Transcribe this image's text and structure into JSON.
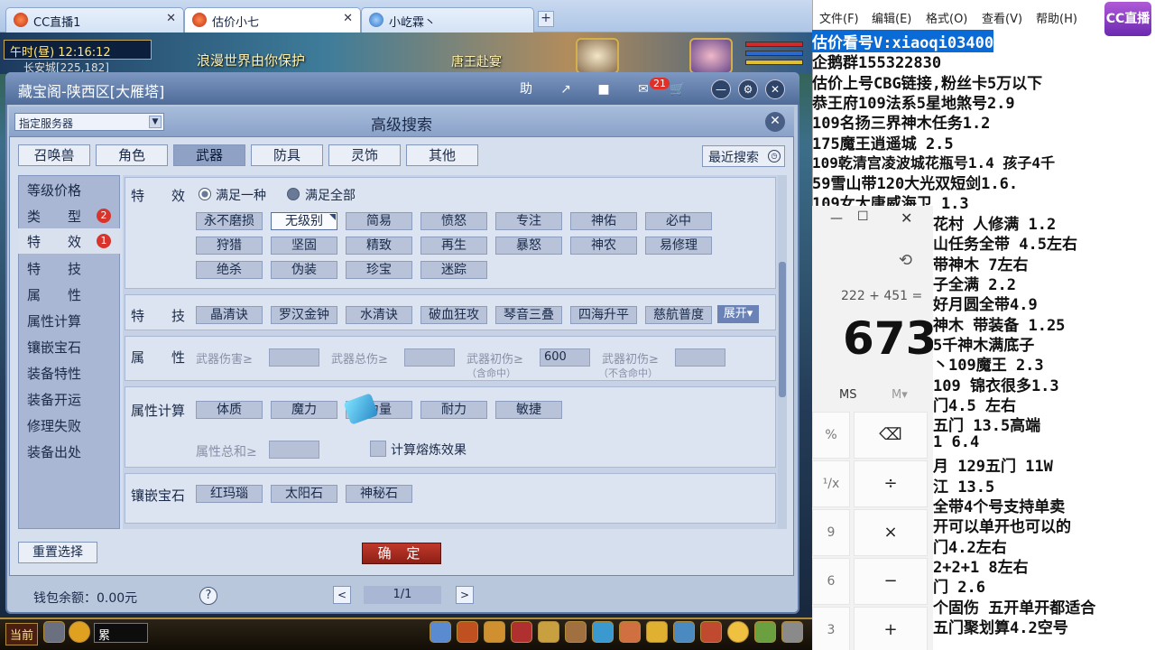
{
  "browser": {
    "tabs": [
      {
        "label": "CC直播1"
      },
      {
        "label": "估价小七"
      },
      {
        "label": "小屹霖丶"
      }
    ],
    "new_tab": "+"
  },
  "game": {
    "clock": "午时(昼)  12:16:12",
    "location": "长安城[225,182]",
    "banner_left": "浪漫世界由你保护",
    "banner_right": "唐王赴宴",
    "bottom_bar": {
      "label": "当前",
      "input_value": "累"
    }
  },
  "window": {
    "title": "藏宝阁-陕西区[大雁塔]",
    "buttons": {
      "help": "助",
      "share": "↗",
      "stop": "■",
      "messages_badge": "21",
      "cart": "🛒",
      "minimize": "—",
      "settings": "⚙",
      "close": "✕"
    }
  },
  "dialog": {
    "server_placeholder": "指定服务器",
    "title": "高级搜索",
    "close": "✕",
    "categories": [
      "召唤兽",
      "角色",
      "武器",
      "防具",
      "灵饰",
      "其他"
    ],
    "active_category": "武器",
    "recent_search": "最近搜索",
    "sidebar": [
      {
        "label": "等级价格",
        "badge": ""
      },
      {
        "label": "类　　型",
        "badge": "2"
      },
      {
        "label": "特　　效",
        "badge": "1"
      },
      {
        "label": "特　　技",
        "badge": ""
      },
      {
        "label": "属　　性",
        "badge": ""
      },
      {
        "label": "属性计算",
        "badge": ""
      },
      {
        "label": "镶嵌宝石",
        "badge": ""
      },
      {
        "label": "装备特性",
        "badge": ""
      },
      {
        "label": "装备开运",
        "badge": ""
      },
      {
        "label": "修理失败",
        "badge": ""
      },
      {
        "label": "装备出处",
        "badge": ""
      }
    ],
    "effects": {
      "label": "特　　效",
      "options": [
        "满足一种",
        "满足全部"
      ],
      "selected_option": "满足全部",
      "chips": [
        "永不磨损",
        "无级别",
        "简易",
        "愤怒",
        "专注",
        "神佑",
        "必中",
        "狩猎",
        "坚固",
        "精致",
        "再生",
        "暴怒",
        "神农",
        "易修理",
        "绝杀",
        "伪装",
        "珍宝",
        "迷踪"
      ],
      "selected_chip": "无级别"
    },
    "skills": {
      "label": "特　　技",
      "chips": [
        "晶清诀",
        "罗汉金钟",
        "水清诀",
        "破血狂攻",
        "琴音三叠",
        "四海升平",
        "慈航普度"
      ],
      "expand": "展开▾"
    },
    "attributes": {
      "label": "属　　性",
      "fields": [
        {
          "label": "武器伤害≥",
          "value": "",
          "sub": ""
        },
        {
          "label": "武器总伤≥",
          "value": "",
          "sub": ""
        },
        {
          "label": "武器初伤≥",
          "value": "600",
          "sub": "（含命中）"
        },
        {
          "label": "武器初伤≥",
          "value": "",
          "sub": "（不含命中）"
        }
      ]
    },
    "attr_calc": {
      "label": "属性计算",
      "chips": [
        "体质",
        "魔力",
        "力量",
        "耐力",
        "敏捷"
      ],
      "total_label": "属性总和≥",
      "total_value": "",
      "checkbox_label": "计算熔炼效果"
    },
    "gems": {
      "label": "镶嵌宝石",
      "chips": [
        "红玛瑙",
        "太阳石",
        "神秘石"
      ]
    },
    "reset": "重置选择",
    "confirm": "确 定"
  },
  "footer": {
    "wallet": "钱包余额：0.00元",
    "help": "?",
    "prev": "<",
    "page": "1/1",
    "next": ">"
  },
  "notepad": {
    "menu": [
      "文件(F)",
      "编辑(E)",
      "格式(O)",
      "查看(V)",
      "帮助(H)"
    ],
    "logo": "CC直播",
    "lines_full": [
      "估价看号V:xiaoqi03400",
      "企鹅群155322830",
      "估价上号CBG链接,粉丝卡5万以下",
      "恭王府109法系5星地煞号2.9",
      "109名扬三界神木任务1.2",
      "175魔王逍遥城 2.5",
      "109乾清宫凌波城花瓶号1.4 孩子4千",
      "59雪山带120大光双短剑1.6.",
      "109女大唐威海卫  1.3"
    ],
    "lines_partial": [
      "花村 人修满 1.2",
      "山任务全带 4.5左右",
      "带神木  7左右",
      "子全满 2.2",
      "好月圆全带4.9",
      "神木 带装备  1.25",
      " 5千神木满底子",
      "丶109魔王 2.3",
      "109  锦衣很多1.3",
      "门4.5 左右",
      "五门  13.5高端",
      "1  6.4",
      "月 129五门 11W",
      "江 13.5",
      "全带4个号支持单卖",
      "开可以单开也可以的",
      "门4.2左右",
      " 2+2+1 8左右",
      "门  2.6",
      "个固伤 五开单开都适合",
      "五门聚划算4.2空号"
    ]
  },
  "calculator": {
    "expression": "222 + 451 =",
    "result": "673",
    "memory": [
      "MS",
      "M▾"
    ],
    "keys": [
      "⌫",
      "÷",
      "×",
      "−",
      "+"
    ]
  }
}
